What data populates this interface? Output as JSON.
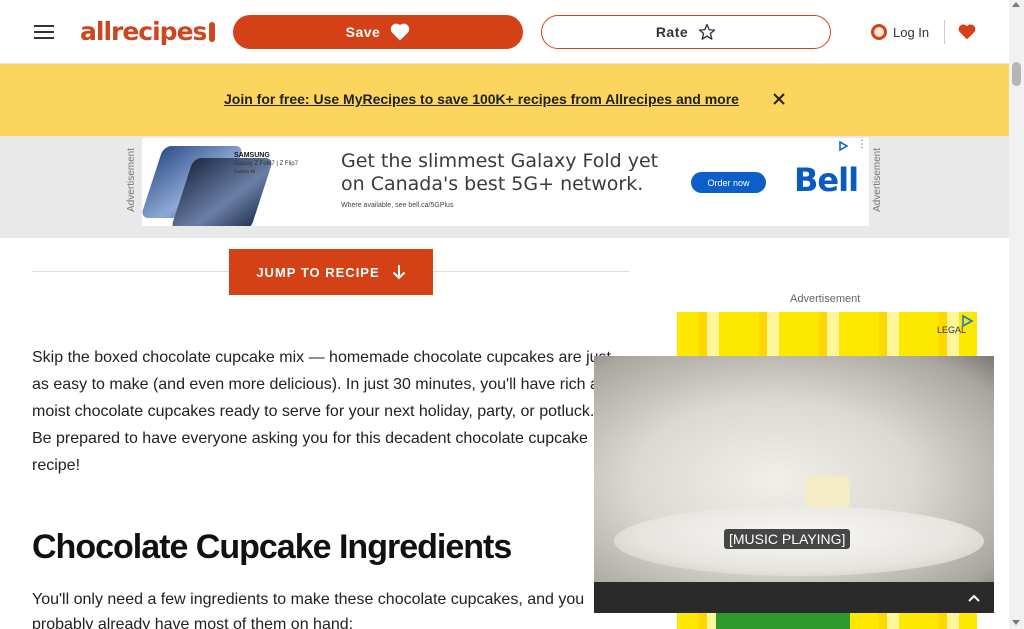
{
  "header": {
    "logo_text": "allrecipes",
    "save_label": "Save",
    "rate_label": "Rate",
    "login_label": "Log In"
  },
  "promo": {
    "text": "Join for free: Use MyRecipes to save 100K+ recipes from Allrecipes and more"
  },
  "top_ad": {
    "side_label": "Advertisement",
    "brand": "SAMSUNG",
    "model": "Galaxy Z Fold7 | Z Flip7",
    "ai_tag": "Galaxy AI",
    "headline": "Get the slimmest Galaxy Fold yet on Canada's best 5G+ network.",
    "fine_print": "Where available, see bell.ca/5GPlus",
    "cta": "Order now",
    "advertiser": "Bell"
  },
  "jump_button": {
    "label": "JUMP TO RECIPE"
  },
  "article": {
    "intro": "Skip the boxed chocolate cupcake mix — homemade chocolate cupcakes are just as easy to make (and even more delicious). In just 30 minutes, you'll have rich and moist chocolate cupcakes ready to serve for your next holiday, party, or potluck. Be prepared to have everyone asking you for this decadent chocolate cupcake recipe!",
    "heading": "Chocolate Cupcake Ingredients",
    "ingredients_intro": "You'll only need a few ingredients to make these chocolate cupcakes, and you probably already have most of them on hand:"
  },
  "rail_ad": {
    "label": "Advertisement",
    "legal": "LEGAL"
  },
  "video": {
    "caption": "[MUSIC PLAYING]"
  },
  "icons": {
    "menu": "hamburger-menu-icon",
    "save_heart": "heart-icon",
    "rate_star": "star-icon",
    "user": "user-icon",
    "favorites": "heart-icon",
    "close": "close-icon",
    "jump_arrow": "arrow-down-icon",
    "collapse": "chevron-up-icon"
  },
  "colors": {
    "brand": "#d54116",
    "promo_bg": "#fcd55f",
    "ad_band_bg": "#e9e9e9"
  }
}
